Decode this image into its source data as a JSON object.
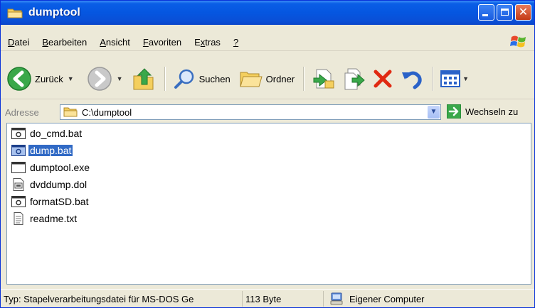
{
  "window": {
    "title": "dumptool"
  },
  "menubar": {
    "items": [
      {
        "pre": "",
        "u": "D",
        "post": "atei"
      },
      {
        "pre": "",
        "u": "B",
        "post": "earbeiten"
      },
      {
        "pre": "",
        "u": "A",
        "post": "nsicht"
      },
      {
        "pre": "",
        "u": "F",
        "post": "avoriten"
      },
      {
        "pre": "E",
        "u": "x",
        "post": "tras"
      },
      {
        "pre": "",
        "u": "?",
        "post": ""
      }
    ]
  },
  "toolbar": {
    "back_label": "Zurück",
    "search_label": "Suchen",
    "folders_label": "Ordner"
  },
  "addressbar": {
    "label": "Adresse",
    "path": "C:\\dumptool",
    "go_label": "Wechseln zu"
  },
  "files": [
    {
      "name": "do_cmd.bat",
      "icon": "batch-file-icon"
    },
    {
      "name": "dump.bat",
      "icon": "batch-file-icon",
      "selected": true
    },
    {
      "name": "dumptool.exe",
      "icon": "exe-file-icon"
    },
    {
      "name": "dvddump.dol",
      "icon": "dol-file-icon"
    },
    {
      "name": "formatSD.bat",
      "icon": "batch-file-icon"
    },
    {
      "name": "readme.txt",
      "icon": "text-file-icon"
    }
  ],
  "statusbar": {
    "type_text": "Typ: Stapelverarbeitungsdatei für MS-DOS Ge",
    "size_text": "113 Byte",
    "location_text": "Eigener Computer"
  },
  "colors": {
    "titlebar": "#0556e0",
    "selection": "#316ac5",
    "chrome": "#ece9d8",
    "close_button": "#c43a16"
  }
}
